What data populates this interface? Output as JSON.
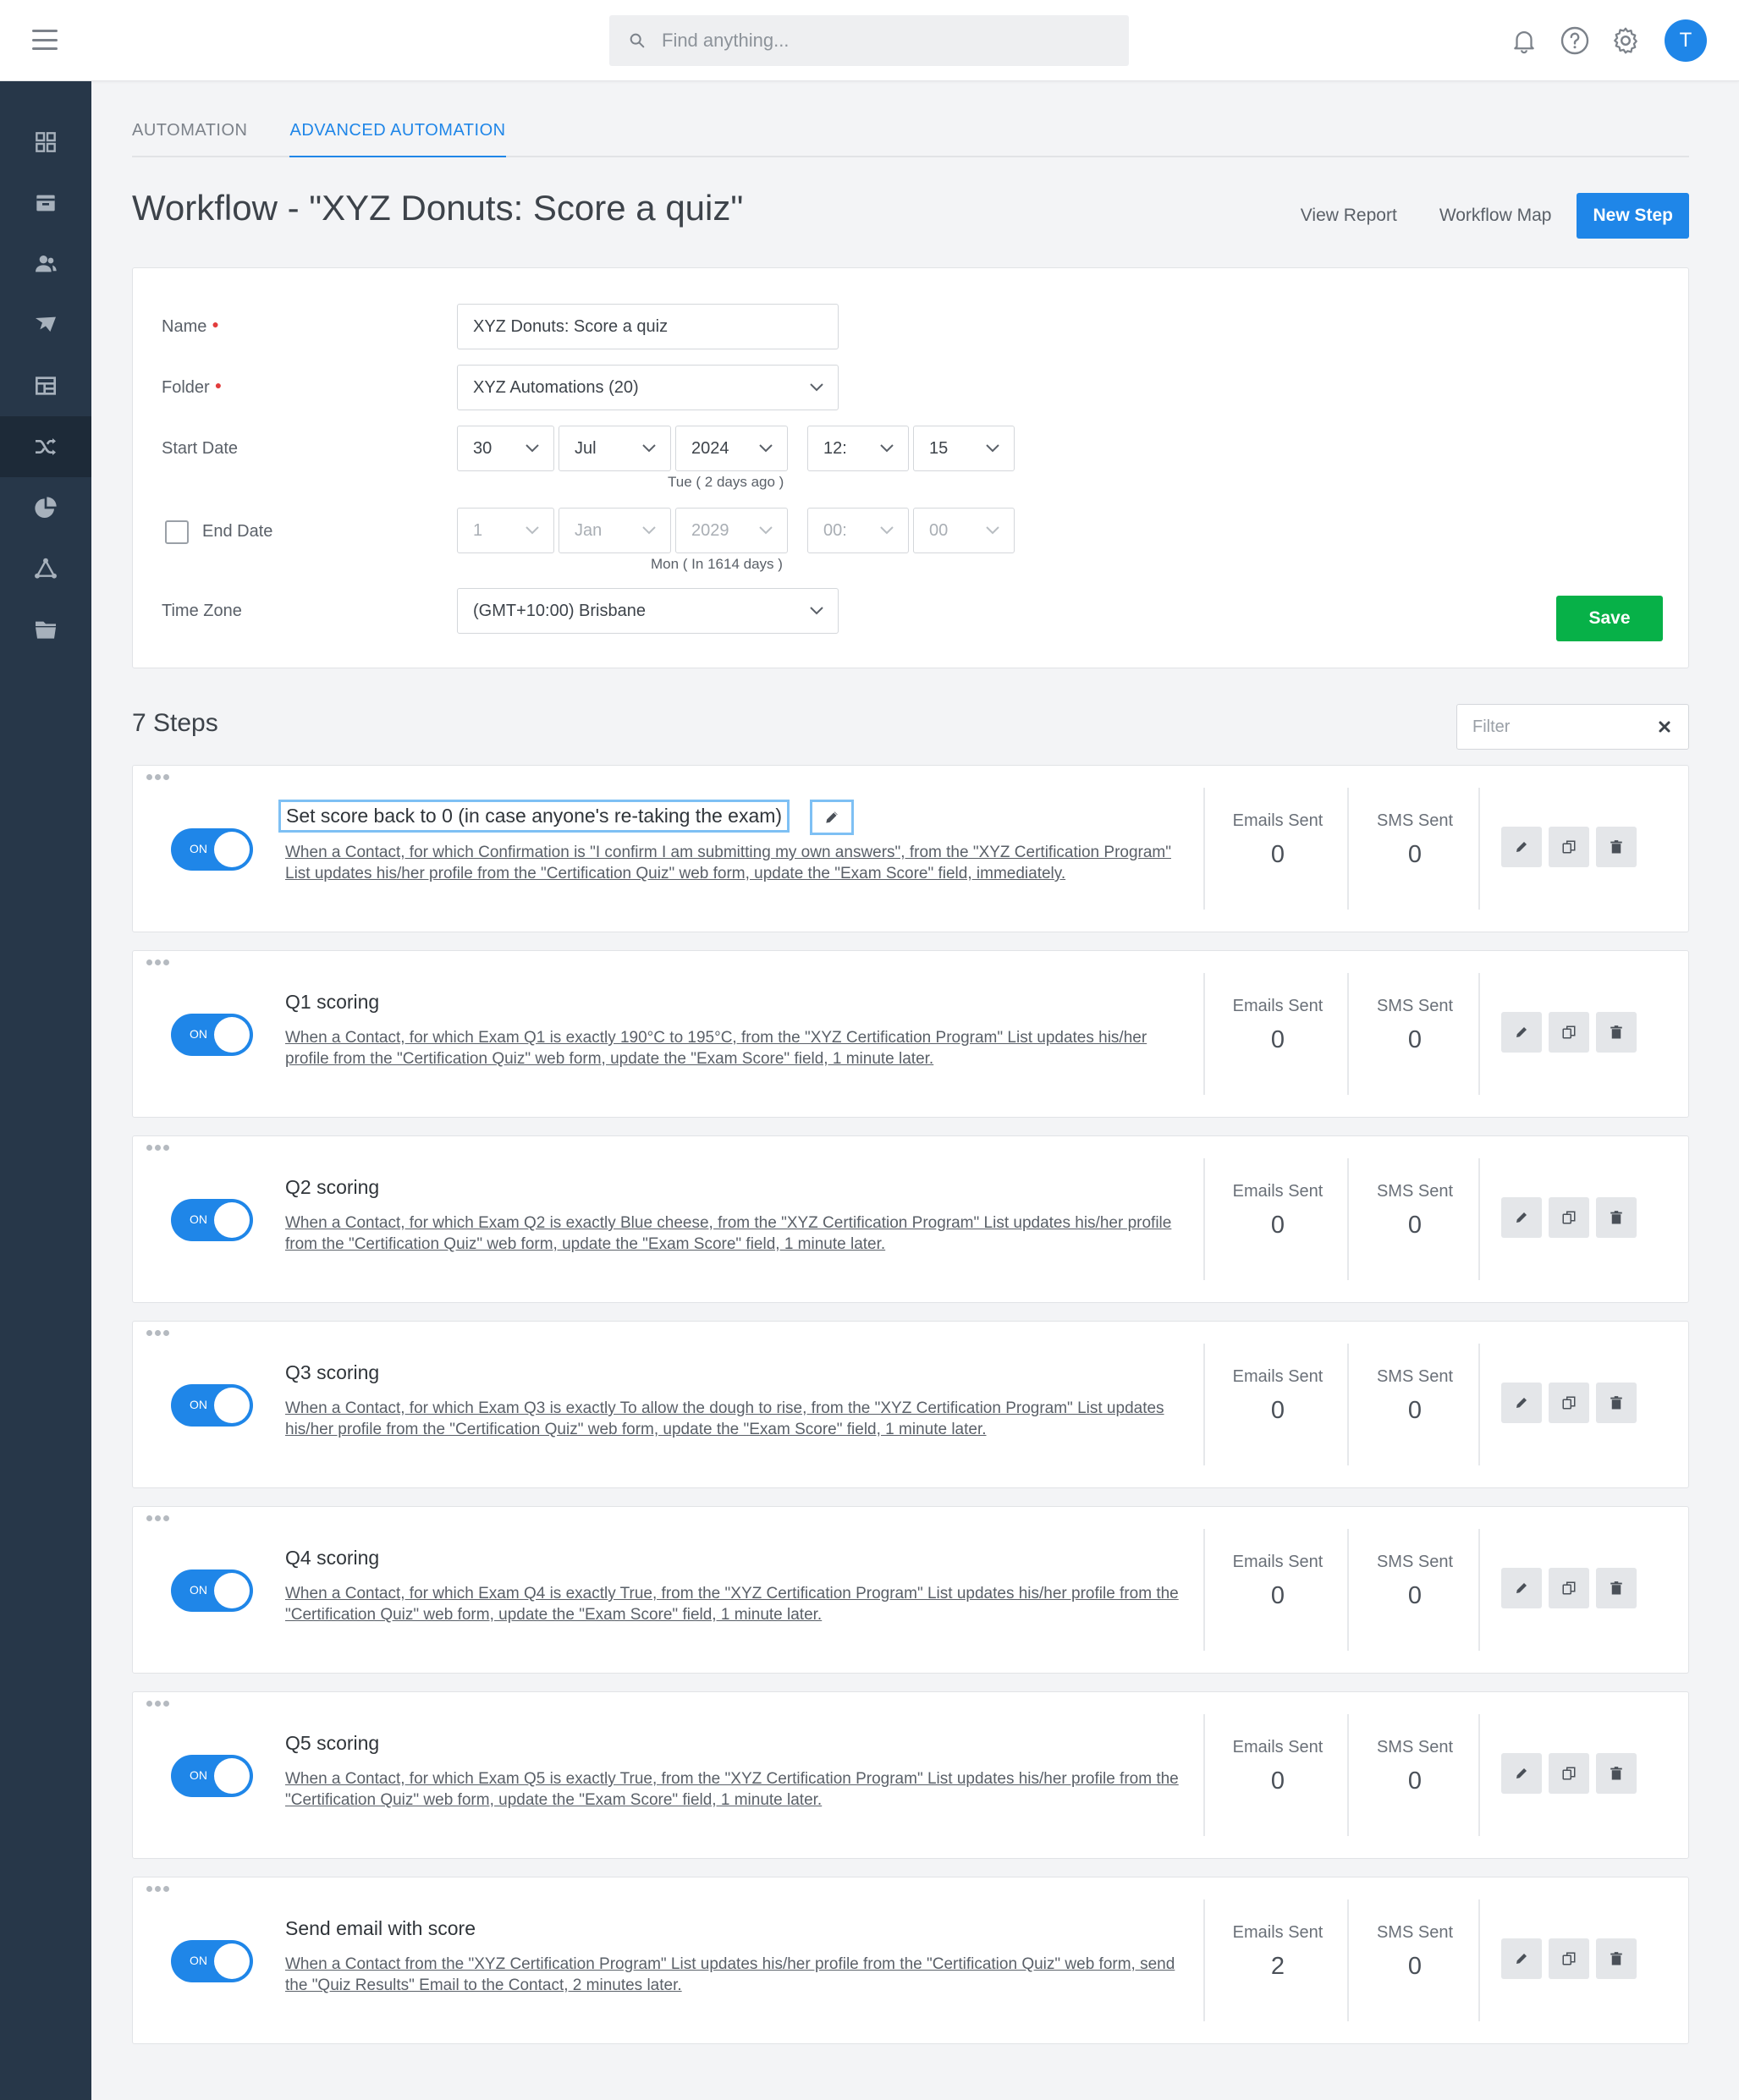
{
  "topbar": {
    "search_placeholder": "Find anything...",
    "avatar_initial": "T"
  },
  "tabs": [
    "AUTOMATION",
    "ADVANCED AUTOMATION"
  ],
  "page": {
    "title": "Workflow - \"XYZ Donuts: Score a quiz\"",
    "view_report": "View Report",
    "workflow_map": "Workflow Map",
    "new_step": "New Step"
  },
  "form": {
    "name_label": "Name",
    "name_value": "XYZ Donuts: Score a quiz",
    "folder_label": "Folder",
    "folder_value": "XYZ Automations (20)",
    "start_label": "Start Date",
    "start_day": "30",
    "start_month": "Jul",
    "start_year": "2024",
    "start_hour": "12:",
    "start_min": "15",
    "start_hint": "Tue ( 2 days ago )",
    "end_label": "End Date",
    "end_day": "1",
    "end_month": "Jan",
    "end_year": "2029",
    "end_hour": "00:",
    "end_min": "00",
    "end_hint": "Mon ( In 1614 days )",
    "tz_label": "Time Zone",
    "tz_value": "(GMT+10:00) Brisbane",
    "save": "Save"
  },
  "steps_header": {
    "title": "7 Steps",
    "filter_placeholder": "Filter"
  },
  "stat_labels": {
    "emails": "Emails Sent",
    "sms": "SMS Sent"
  },
  "toggle_label": "ON",
  "steps": [
    {
      "name": "Set score back to 0 (in case anyone's re-taking the exam)",
      "desc": "When a Contact, for which Confirmation is \"I confirm I am submitting my own answers\", from the \"XYZ Certification Program\" List updates his/her profile from the \"Certification Quiz\" web form, update the \"Exam Score\" field, immediately.",
      "emails": "0",
      "sms": "0"
    },
    {
      "name": "Q1 scoring",
      "desc": "When a Contact, for which Exam Q1 is exactly 190°C to 195°C, from the \"XYZ Certification Program\" List updates his/her profile from the \"Certification Quiz\" web form, update the \"Exam Score\" field, 1 minute later.",
      "emails": "0",
      "sms": "0"
    },
    {
      "name": "Q2 scoring",
      "desc": "When a Contact, for which Exam Q2 is exactly Blue cheese, from the \"XYZ Certification Program\" List updates his/her profile from the \"Certification Quiz\" web form, update the \"Exam Score\" field, 1 minute later.",
      "emails": "0",
      "sms": "0"
    },
    {
      "name": "Q3 scoring",
      "desc": "When a Contact, for which Exam Q3 is exactly To allow the dough to rise, from the \"XYZ Certification Program\" List updates his/her profile from the \"Certification Quiz\" web form, update the \"Exam Score\" field, 1 minute later.",
      "emails": "0",
      "sms": "0"
    },
    {
      "name": "Q4 scoring",
      "desc": "When a Contact, for which Exam Q4 is exactly True, from the \"XYZ Certification Program\" List updates his/her profile from the \"Certification Quiz\" web form, update the \"Exam Score\" field, 1 minute later.",
      "emails": "0",
      "sms": "0"
    },
    {
      "name": "Q5 scoring",
      "desc": "When a Contact, for which Exam Q5 is exactly True, from the \"XYZ Certification Program\" List updates his/her profile from the \"Certification Quiz\" web form, update the \"Exam Score\" field, 1 minute later.",
      "emails": "0",
      "sms": "0"
    },
    {
      "name": "Send email with score",
      "desc": "When a Contact from the \"XYZ Certification Program\" List updates his/her profile from the \"Certification Quiz\" web form, send the \"Quiz Results\" Email to the Contact, 2 minutes later.",
      "emails": "2",
      "sms": "0"
    }
  ],
  "colors": {
    "accent": "#1f86e8",
    "save": "#07b148",
    "sidebar": "#273749",
    "focus": "#7ec0f4"
  },
  "icons": {
    "sidebar": [
      "dashboard-icon",
      "inbox-icon",
      "contacts-icon",
      "campaigns-icon",
      "templates-icon",
      "automation-icon",
      "reports-icon",
      "integrations-icon",
      "files-icon"
    ],
    "topbar": [
      "bell-icon",
      "help-icon",
      "gear-icon"
    ]
  }
}
